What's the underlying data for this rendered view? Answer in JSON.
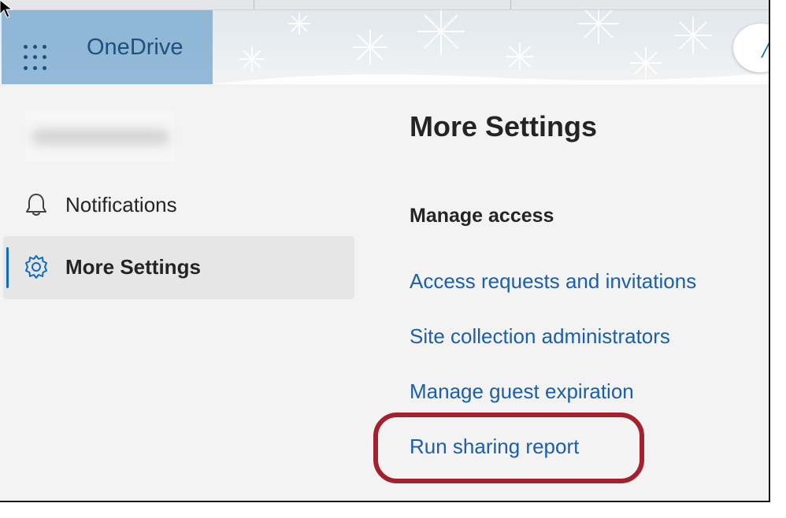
{
  "header": {
    "app_name": "OneDrive",
    "icons": {
      "app_launcher": "waffle-grid-icon",
      "header_button": "chevron-up-icon"
    }
  },
  "sidebar": {
    "items": [
      {
        "label": "Notifications",
        "icon": "bell-icon",
        "selected": false
      },
      {
        "label": "More Settings",
        "icon": "gear-icon",
        "selected": true
      }
    ]
  },
  "main": {
    "title": "More Settings",
    "section_heading": "Manage access",
    "links": [
      "Access requests and invitations",
      "Site collection administrators",
      "Manage guest expiration",
      "Run sharing report"
    ],
    "highlighted_link": "Run sharing report"
  },
  "colors": {
    "link": "#1a5fa8",
    "accent": "#0f6cbd",
    "highlight_ring": "#a3202e",
    "brand_bar": "#78a8d0"
  }
}
